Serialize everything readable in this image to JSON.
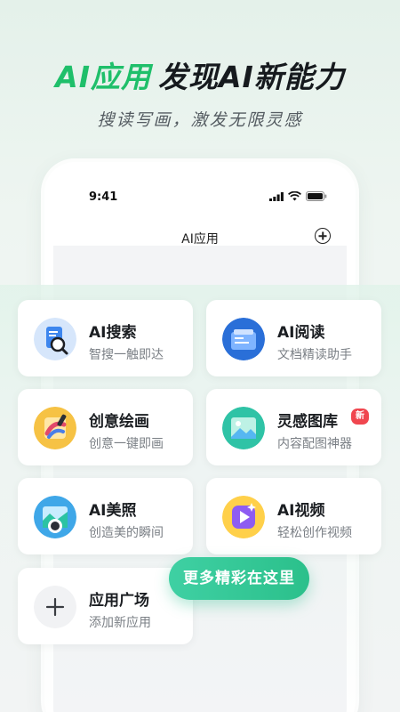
{
  "hero": {
    "accent": "AI应用",
    "title": "发现AI新能力",
    "subtitle": "搜读写画，激发无限灵感"
  },
  "phone": {
    "status_time": "9:41",
    "app_title": "AI应用"
  },
  "cards": [
    {
      "title": "AI搜索",
      "subtitle": "智搜一触即达",
      "icon": "search-document-icon"
    },
    {
      "title": "AI阅读",
      "subtitle": "文档精读助手",
      "icon": "reading-icon"
    },
    {
      "title": "创意绘画",
      "subtitle": "创意一键即画",
      "icon": "paint-palette-icon"
    },
    {
      "title": "灵感图库",
      "subtitle": "内容配图神器",
      "icon": "image-gallery-icon",
      "badge": "新"
    },
    {
      "title": "AI美照",
      "subtitle": "创造美的瞬间",
      "icon": "camera-photo-icon"
    },
    {
      "title": "AI视频",
      "subtitle": "轻松创作视频",
      "icon": "video-play-icon"
    },
    {
      "title": "应用广场",
      "subtitle": "添加新应用",
      "icon": "plus-icon"
    }
  ],
  "more_button": "更多精彩在这里",
  "colors": {
    "accent": "#1fbf6a",
    "pill": "#2bc08b",
    "badge": "#f0464f"
  }
}
